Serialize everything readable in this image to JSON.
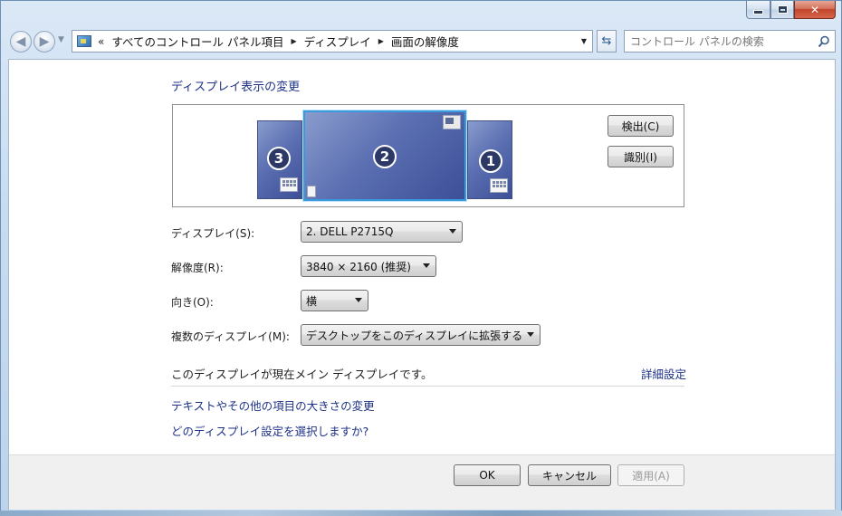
{
  "window": {
    "caption_buttons": {
      "minimize_icon": "minimize-icon",
      "maximize_icon": "maximize-icon",
      "close_label": "✕"
    }
  },
  "nav": {
    "back_icon": "back-arrow-icon",
    "forward_icon": "forward-arrow-icon",
    "overflow": "«",
    "breadcrumbs": [
      "すべてのコントロール パネル項目",
      "ディスプレイ",
      "画面の解像度"
    ],
    "search_placeholder": "コントロール パネルの検索"
  },
  "main": {
    "heading": "ディスプレイ表示の変更",
    "monitors": [
      {
        "number": "3",
        "selected": false
      },
      {
        "number": "2",
        "selected": true
      },
      {
        "number": "1",
        "selected": false
      }
    ],
    "detect_button": "検出(C)",
    "identify_button": "識別(I)",
    "fields": {
      "display": {
        "label": "ディスプレイ(S):",
        "value": "2. DELL P2715Q"
      },
      "resolution": {
        "label": "解像度(R):",
        "value": "3840 × 2160 (推奨)"
      },
      "orientation": {
        "label": "向き(O):",
        "value": "横"
      },
      "multiple": {
        "label": "複数のディスプレイ(M):",
        "value": "デスクトップをこのディスプレイに拡張する"
      }
    },
    "main_display_text": "このディスプレイが現在メイン ディスプレイです。",
    "advanced_link": "詳細設定",
    "links": [
      "テキストやその他の項目の大きさの変更",
      "どのディスプレイ設定を選択しますか?"
    ]
  },
  "footer": {
    "ok": "OK",
    "cancel": "キャンセル",
    "apply": "適用(A)"
  },
  "colors": {
    "link": "#1e3287",
    "selected_border": "#3a9bdc",
    "monitor_fill": "#5b6fb2"
  }
}
